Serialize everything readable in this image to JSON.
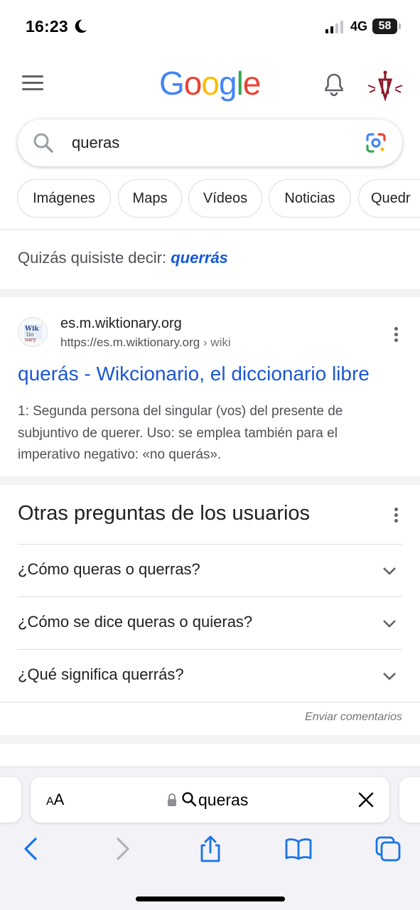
{
  "status": {
    "time": "16:23",
    "network": "4G",
    "battery": "58"
  },
  "header": {
    "logo": [
      "G",
      "o",
      "o",
      "g",
      "l",
      "e"
    ],
    "logo_colors": [
      "#4285F4",
      "#EA4335",
      "#FBBC05",
      "#4285F4",
      "#34A853",
      "#EA4335"
    ]
  },
  "search": {
    "query": "queras"
  },
  "chips": [
    "Imágenes",
    "Maps",
    "Vídeos",
    "Noticias",
    "Quedr"
  ],
  "did_you_mean": {
    "prefix": "Quizás quisiste decir: ",
    "suggestion": "querrás"
  },
  "result": {
    "site_name": "es.m.wiktionary.org",
    "url": "https://es.m.wiktionary.org",
    "breadcrumb": " › wiki",
    "title": "querás - Wikcionario, el diccionario libre",
    "snippet": "1: Segunda persona del singular (vos) del presente de subjuntivo de querer. Uso: se emplea también para el imperativo negativo: «no querás»."
  },
  "paa": {
    "title": "Otras preguntas de los usuarios",
    "questions": [
      "¿Cómo queras o querras?",
      "¿Cómo se dice queras o quieras?",
      "¿Qué significa querrás?"
    ],
    "feedback": "Enviar comentarios"
  },
  "safari": {
    "aa_small": "A",
    "aa_large": "A",
    "url": "queras"
  },
  "colors": {
    "link": "#1a57d4",
    "icon_grey": "#5f6368",
    "ios_blue": "#1a73e8"
  }
}
